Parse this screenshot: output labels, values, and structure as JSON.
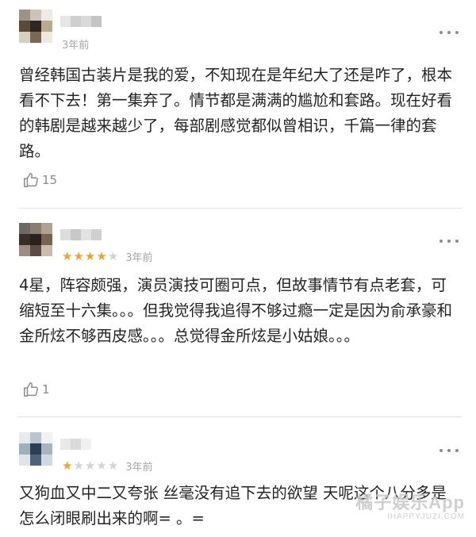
{
  "reviews": [
    {
      "time": "3年前",
      "rating": null,
      "text": "曾经韩国古装片是我的爱，不知现在是年纪大了还是咋了，根本看不下去！第一集弃了。情节都是满满的尴尬和套路。现在好看的韩剧是越来越少了，每部剧感觉都似曾相识，千篇一律的套路。",
      "likes": "15",
      "avatar_colors": [
        "#9a9386",
        "#c9c3b8",
        "#efeae3",
        "#5a4a38",
        "#2f2620",
        "#b8a990",
        "#d9cfc0",
        "#7a6a55",
        "#eee8df"
      ],
      "name_colors": [
        "#e6e6e6",
        "#cfcfcf",
        "#d9d9d9",
        "#c4c4c4"
      ]
    },
    {
      "time": "3年前",
      "rating": 4,
      "text": "4星，阵容颇强，演员演技可圈可点，但故事情节有点老套，可缩短至十六集。。。但我觉得我追得不够过瘾一定是因为俞承豪和金所炫不够西皮感。。。总觉得金所炫是小姑娘。。。",
      "likes": "1",
      "avatar_colors": [
        "#6c6a66",
        "#8a7e70",
        "#b0a190",
        "#3a2f28",
        "#2a211c",
        "#7a6250",
        "#9c8d7e",
        "#5c4d42",
        "#c9bcae"
      ],
      "name_colors": [
        "#dcdcdc",
        "#c8c8c8",
        "#e2e2e2",
        "#d0d0d0"
      ]
    },
    {
      "time": "3年前",
      "rating": 1,
      "text": "又狗血又中二又夸张 丝毫没有追下去的欲望 天呢这个八分多是怎么闭眼刷出来的啊= 。=",
      "likes": "",
      "avatar_colors": [
        "#e8ecef",
        "#b8c6cf",
        "#f2f2f2",
        "#9fb0bc",
        "#2d3d52",
        "#a7b5bf",
        "#dfe4e8",
        "#4f6378",
        "#cfd8de"
      ],
      "name_colors": [
        "#e8e8e8",
        "#dadada",
        "#f0f0f0",
        "#ffffff"
      ]
    }
  ],
  "icons": {
    "like": "thumbs-up-icon",
    "more": "more-dots-icon"
  },
  "colors": {
    "star_on": "#f4a12a",
    "star_off": "#d3d3d3",
    "divider": "#e3e3e3"
  },
  "watermark": {
    "main": "橘子娱乐App",
    "sub": "IHAPPYJUZI.COM"
  }
}
